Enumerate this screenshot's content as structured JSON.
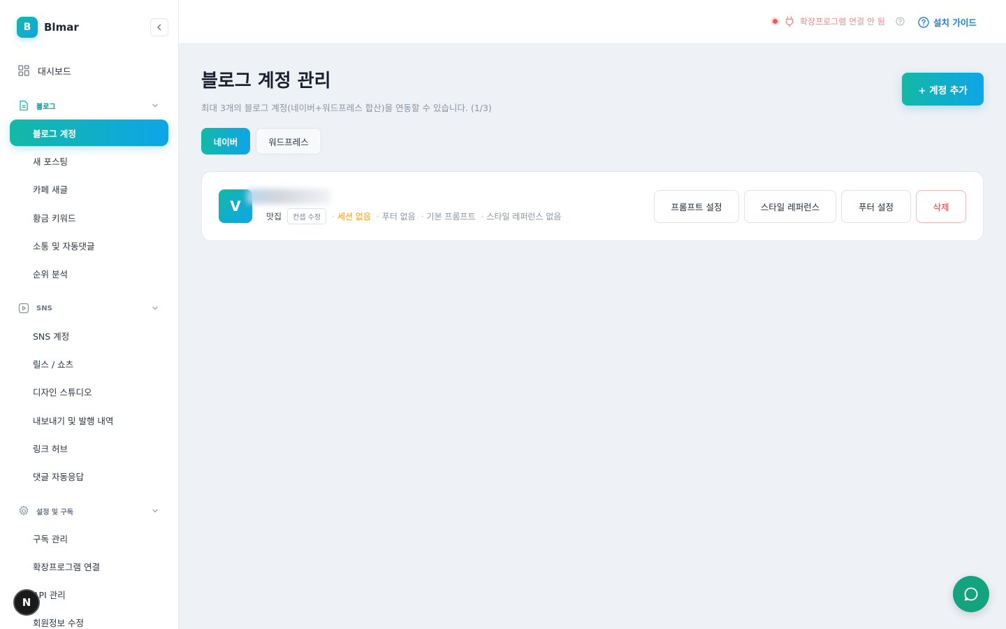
{
  "brand": {
    "logo_letter": "B",
    "name": "Blmar"
  },
  "sidebar": {
    "dashboard_label": "대시보드",
    "blog_section": {
      "label": "블로그",
      "items": [
        "블로그 계정",
        "새 포스팅",
        "카페 새글",
        "황금 키워드",
        "소통 및 자동댓글",
        "순위 분석"
      ]
    },
    "sns_section": {
      "label": "SNS",
      "items": [
        "SNS 계정",
        "릴스 / 쇼츠",
        "디자인 스튜디오",
        "내보내기 및 발행 내역",
        "링크 허브",
        "댓글 자동응답"
      ]
    },
    "settings_section": {
      "label": "설정 및 구독",
      "items": [
        "구독 관리",
        "확장프로그램 연결",
        "API 관리",
        "회원정보 수정"
      ]
    },
    "active_item": "블로그 계정",
    "n_badge": "N"
  },
  "topbar": {
    "extension_status": "확장프로그램 연결 안 됨",
    "install_guide": "설치 가이드"
  },
  "main": {
    "title": "블로그 계정 관리",
    "subtitle": "최대 3개의 블로그 계정(네이버+워드프레스 합산)을 연동할 수 있습니다. (1/3)",
    "add_button": "+ 계정 추가",
    "tabs": [
      {
        "label": "네이버",
        "active": true
      },
      {
        "label": "워드프레스",
        "active": false
      }
    ],
    "account": {
      "avatar_letter": "V",
      "category": "맛집",
      "concept_edit": "컨셉 수정",
      "session": "세션 없음",
      "footer": "푸터 없음",
      "prompt": "기본 프롬프트",
      "style_ref": "스타일 레퍼런스 없음",
      "buttons": {
        "prompt": "프롬프트 설정",
        "style": "스타일 레퍼런스",
        "footer": "푸터 설정",
        "delete": "삭제"
      }
    }
  },
  "colors": {
    "accent_start": "#14b8a6",
    "accent_end": "#0ea5e9",
    "warning": "#f59e0b",
    "danger": "#e0474c",
    "status_error": "#f05a5a"
  },
  "icons": [
    "grid-icon",
    "document-icon",
    "play-square-icon",
    "gear-icon",
    "chevron-down-icon",
    "chevron-left-icon",
    "plug-icon",
    "question-circle-icon",
    "chat-bubble-icon"
  ]
}
